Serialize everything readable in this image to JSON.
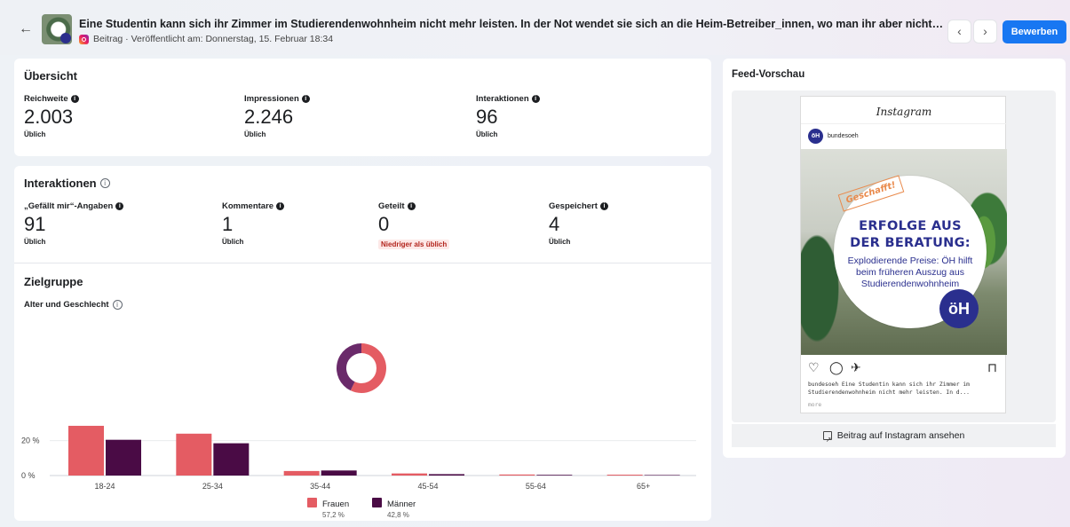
{
  "header": {
    "back_icon": "arrow-left-icon",
    "title": "Eine Studentin kann sich ihr Zimmer im Studierendenwohnheim nicht mehr leisten. In der Not wendet sie sich an die Heim-Betreiber_innen, wo man ihr aber nicht entgegenkommt…",
    "meta": "Beitrag · Veröffentlicht am: Donnerstag, 15. Februar 18:34",
    "prev_icon": "chevron-left-icon",
    "next_icon": "chevron-right-icon",
    "boost_label": "Bewerben"
  },
  "overview": {
    "title": "Übersicht",
    "metrics": [
      {
        "label": "Reichweite",
        "value": "2.003",
        "note": "Üblich"
      },
      {
        "label": "Impressionen",
        "value": "2.246",
        "note": "Üblich"
      },
      {
        "label": "Interaktionen",
        "value": "96",
        "note": "Üblich"
      }
    ]
  },
  "interactions": {
    "title": "Interaktionen",
    "metrics": [
      {
        "label": "„Gefällt mir“-Angaben",
        "value": "91",
        "note": "Üblich"
      },
      {
        "label": "Kommentare",
        "value": "1",
        "note": "Üblich"
      },
      {
        "label": "Geteilt",
        "value": "0",
        "note": "Niedriger als üblich"
      },
      {
        "label": "Gespeichert",
        "value": "4",
        "note": "Üblich"
      }
    ]
  },
  "audience": {
    "title": "Zielgruppe",
    "subtitle": "Alter und Geschlecht"
  },
  "chart_data": {
    "type": "bar",
    "categories": [
      "18-24",
      "25-34",
      "35-44",
      "45-54",
      "55-64",
      "65+"
    ],
    "series": [
      {
        "name": "Frauen",
        "values": [
          28.5,
          24.0,
          2.6,
          1.2,
          0.6,
          0.5
        ],
        "color": "#e45c63"
      },
      {
        "name": "Männer",
        "values": [
          20.5,
          18.5,
          2.9,
          0.8,
          0.4,
          0.3
        ],
        "color": "#4a0b45"
      }
    ],
    "ytick_labels": [
      "0 %",
      "20 %"
    ],
    "yticks": [
      0,
      20
    ],
    "ylim": [
      0,
      30
    ],
    "legend_shares": [
      "57,2 %",
      "42,8 %"
    ],
    "legend": "bottom-center",
    "donut": [
      {
        "name": "Frauen",
        "share": 57.2,
        "color": "#e45c63"
      },
      {
        "name": "Männer",
        "share": 42.8,
        "color": "#6a2a6a"
      }
    ]
  },
  "feed": {
    "title": "Feed-Vorschau",
    "ig_wordmark": "Instagram",
    "username": "bundesoeh",
    "avatar_text": "öH",
    "image": {
      "stamp": "Geschafft!",
      "headline_1": "ERFOLGE AUS",
      "headline_2": "DER BERATUNG:",
      "body": "Explodierende Preise: ÖH hilft beim früheren Auszug aus Studierenden­wohnheim",
      "logo": "öH"
    },
    "caption": "bundesoeh Eine Studentin kann sich ihr Zimmer im Studierendenwohnheim nicht mehr leisten. In d...",
    "more": "more",
    "link_label": "Beitrag auf Instagram ansehen"
  }
}
